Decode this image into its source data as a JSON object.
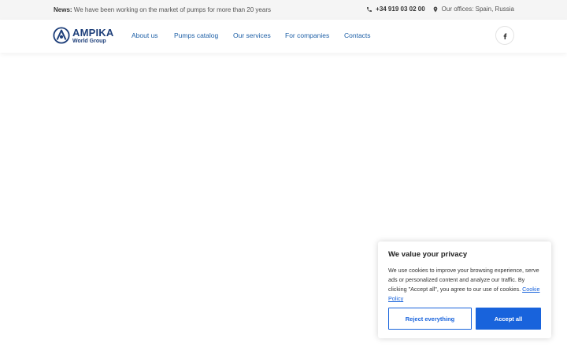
{
  "topbar": {
    "news_label": "News:",
    "news_text": " We have been working on the market of pumps for more than 20 years",
    "phone": "+34 919 03 02 00",
    "offices": "Our offices: Spain, Russia",
    "phone_icon": "phone-icon",
    "location_icon": "location-pin-icon"
  },
  "header": {
    "logo_brand": "AMPIKA",
    "logo_sub": "World Group",
    "nav": [
      "About us",
      "Pumps catalog",
      "Our services",
      "For companies",
      "Contacts"
    ],
    "social_icon": "facebook-icon"
  },
  "cookie": {
    "title": "We value your privacy",
    "text": "We use cookies to improve your browsing experience, serve ads or personalized content and analyze our traffic. By clicking \"Accept all\", you agree to our use of cookies. ",
    "link": "Cookie Policy",
    "reject_label": "Reject everything",
    "accept_label": "Accept all"
  },
  "colors": {
    "brand": "#1e3f7a",
    "nav_link": "#1d5fa6",
    "cookie_accent": "#1863dc"
  }
}
